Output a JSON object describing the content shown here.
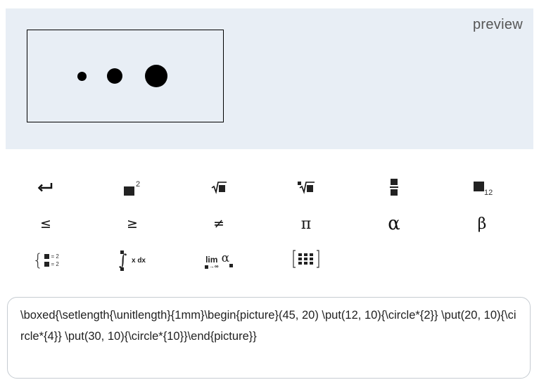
{
  "preview": {
    "label": "preview",
    "picture": {
      "unitlength": "1mm",
      "size": [
        45,
        20
      ],
      "circles": [
        {
          "x": 12,
          "y": 10,
          "diameter": 2
        },
        {
          "x": 20,
          "y": 10,
          "diameter": 4
        },
        {
          "x": 30,
          "y": 10,
          "diameter": 10
        }
      ]
    }
  },
  "toolbar": {
    "buttons": [
      {
        "name": "enter-button",
        "icon": "enter-icon"
      },
      {
        "name": "square-button",
        "icon": "superscript-icon",
        "label": "2"
      },
      {
        "name": "sqrt-button",
        "icon": "sqrt-icon"
      },
      {
        "name": "nthroot-button",
        "icon": "nth-root-icon"
      },
      {
        "name": "fraction-button",
        "icon": "fraction-icon"
      },
      {
        "name": "subscript-button",
        "icon": "subscript-icon",
        "label": "12"
      },
      {
        "name": "leq-button",
        "label": "≤"
      },
      {
        "name": "geq-button",
        "label": "≥"
      },
      {
        "name": "neq-button",
        "label": "≠"
      },
      {
        "name": "pi-button",
        "label": "π"
      },
      {
        "name": "alpha-button",
        "label": "α"
      },
      {
        "name": "beta-button",
        "label": "β"
      },
      {
        "name": "cases-button",
        "icon": "cases-icon",
        "label": "= 2"
      },
      {
        "name": "integral-button",
        "icon": "integral-icon",
        "label": "x dx"
      },
      {
        "name": "limit-button",
        "icon": "limit-icon",
        "label": "lim",
        "sub": "→∞",
        "var": "α"
      },
      {
        "name": "matrix-button",
        "icon": "matrix-icon"
      }
    ]
  },
  "editor": {
    "value": "\\boxed{\\setlength{\\unitlength}{1mm}\\begin{picture}(45, 20) \\put(12, 10){\\circle*{2}} \\put(20, 10){\\circle*{4}} \\put(30, 10){\\circle*{10}}\\end{picture}}"
  }
}
